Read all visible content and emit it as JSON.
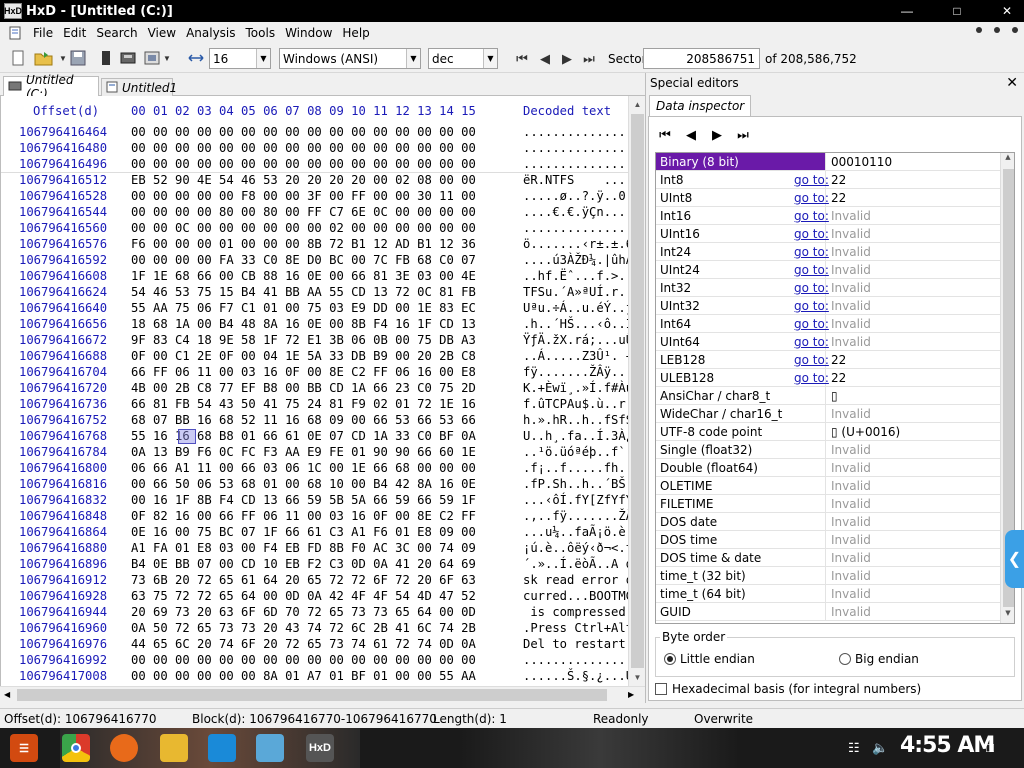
{
  "window": {
    "title": "HxD - [Untitled (C:)]",
    "app_icon_text": "HxD"
  },
  "menu": {
    "items": [
      "File",
      "Edit",
      "Search",
      "View",
      "Analysis",
      "Tools",
      "Window",
      "Help"
    ]
  },
  "toolbar": {
    "bytes_per_row": "16",
    "charset": "Windows (ANSI)",
    "offset_base": "dec",
    "sector_label": "Sector",
    "sector_value": "208586751",
    "sector_of": "of 208,586,752"
  },
  "tabs": [
    {
      "label": "Untitled (C:)"
    },
    {
      "label": "Untitled1"
    }
  ],
  "hex": {
    "header_offset": "Offset(d)",
    "header_cols": "00 01 02 03 04 05 06 07 08 09 10 11 12 13 14 15",
    "header_text": "Decoded text",
    "rows": [
      {
        "off": "106796416464",
        "hex": "00 00 00 00 00 00 00 00 00 00 00 00 00 00 00 00",
        "txt": "................"
      },
      {
        "off": "106796416480",
        "hex": "00 00 00 00 00 00 00 00 00 00 00 00 00 00 00 00",
        "txt": "................"
      },
      {
        "off": "106796416496",
        "hex": "00 00 00 00 00 00 00 00 00 00 00 00 00 00 00 00",
        "txt": "................"
      },
      {
        "off": "106796416512",
        "hex": "EB 52 90 4E 54 46 53 20 20 20 20 00 02 08 00 00",
        "txt": "ëR.NTFS    ....."
      },
      {
        "off": "106796416528",
        "hex": "00 00 00 00 00 F8 00 00 3F 00 FF 00 00 30 11 00",
        "txt": ".....ø..?.ÿ..0.."
      },
      {
        "off": "106796416544",
        "hex": "00 00 00 00 80 00 80 00 FF C7 6E 0C 00 00 00 00",
        "txt": "....€.€.ÿÇn....."
      },
      {
        "off": "106796416560",
        "hex": "00 00 0C 00 00 00 00 00 00 02 00 00 00 00 00 00",
        "txt": "................"
      },
      {
        "off": "106796416576",
        "hex": "F6 00 00 00 01 00 00 00 8B 72 B1 12 AD B1 12 36",
        "txt": "ö.......‹r±.­±.6"
      },
      {
        "off": "106796416592",
        "hex": "00 00 00 00 FA 33 C0 8E D0 BC 00 7C FB 68 C0 07",
        "txt": "....ú3ÀŽÐ¼.|ûhÀ."
      },
      {
        "off": "106796416608",
        "hex": "1F 1E 68 66 00 CB 88 16 0E 00 66 81 3E 03 00 4E",
        "txt": "..hf.Ëˆ...f.>..N"
      },
      {
        "off": "106796416624",
        "hex": "54 46 53 75 15 B4 41 BB AA 55 CD 13 72 0C 81 FB",
        "txt": "TFSu.´A»ªUÍ.r..û"
      },
      {
        "off": "106796416640",
        "hex": "55 AA 75 06 F7 C1 01 00 75 03 E9 DD 00 1E 83 EC",
        "txt": "Uªu.÷Á..u.éÝ..ƒì"
      },
      {
        "off": "106796416656",
        "hex": "18 68 1A 00 B4 48 8A 16 0E 00 8B F4 16 1F CD 13",
        "txt": ".h..´HŠ...‹ô..Í."
      },
      {
        "off": "106796416672",
        "hex": "9F 83 C4 18 9E 58 1F 72 E1 3B 06 0B 00 75 DB A3",
        "txt": "ŸƒÄ.žX.rá;...uÛ£"
      },
      {
        "off": "106796416688",
        "hex": "0F 00 C1 2E 0F 00 04 1E 5A 33 DB B9 00 20 2B C8",
        "txt": "..Á.....Z3Û¹. +È"
      },
      {
        "off": "106796416704",
        "hex": "66 FF 06 11 00 03 16 0F 00 8E C2 FF 06 16 00 E8",
        "txt": "fÿ.......ŽÂÿ...è"
      },
      {
        "off": "106796416720",
        "hex": "4B 00 2B C8 77 EF B8 00 BB CD 1A 66 23 C0 75 2D",
        "txt": "K.+Èwï¸.»Í.f#Àu-"
      },
      {
        "off": "106796416736",
        "hex": "66 81 FB 54 43 50 41 75 24 81 F9 02 01 72 1E 16",
        "txt": "f.ûTCPAu$.ù..r.."
      },
      {
        "off": "106796416752",
        "hex": "68 07 BB 16 68 52 11 16 68 09 00 66 53 66 53 66",
        "txt": "h.».hR..h..fSfSf"
      },
      {
        "off": "106796416768",
        "hex": "55 16 16 68 B8 01 66 61 0E 07 CD 1A 33 C0 BF 0A",
        "txt": "U..h¸.fa..Í.3À¿."
      },
      {
        "off": "106796416784",
        "hex": "0A 13 B9 F6 0C FC F3 AA E9 FE 01 90 90 66 60 1E",
        "txt": "..¹ö.üóªéþ..f`."
      },
      {
        "off": "106796416800",
        "hex": "06 66 A1 11 00 66 03 06 1C 00 1E 66 68 00 00 00",
        "txt": ".f¡..f.....fh..."
      },
      {
        "off": "106796416816",
        "hex": "00 66 50 06 53 68 01 00 68 10 00 B4 42 8A 16 0E",
        "txt": ".fP.Sh..h..´BŠ.."
      },
      {
        "off": "106796416832",
        "hex": "00 16 1F 8B F4 CD 13 66 59 5B 5A 66 59 66 59 1F",
        "txt": "...‹ôÍ.fY[ZfYfY."
      },
      {
        "off": "106796416848",
        "hex": "0F 82 16 00 66 FF 06 11 00 03 16 0F 00 8E C2 FF",
        "txt": ".‚..fÿ.......ŽÂÿ"
      },
      {
        "off": "106796416864",
        "hex": "0E 16 00 75 BC 07 1F 66 61 C3 A1 F6 01 E8 09 00",
        "txt": "...u¼..faÃ¡ö.è.."
      },
      {
        "off": "106796416880",
        "hex": "A1 FA 01 E8 03 00 F4 EB FD 8B F0 AC 3C 00 74 09",
        "txt": "¡ú.è..ôëý‹ð¬<.t."
      },
      {
        "off": "106796416896",
        "hex": "B4 0E BB 07 00 CD 10 EB F2 C3 0D 0A 41 20 64 69",
        "txt": "´.»..Í.ëòÃ..A di"
      },
      {
        "off": "106796416912",
        "hex": "73 6B 20 72 65 61 64 20 65 72 72 6F 72 20 6F 63",
        "txt": "sk read error oc"
      },
      {
        "off": "106796416928",
        "hex": "63 75 72 72 65 64 00 0D 0A 42 4F 4F 54 4D 47 52",
        "txt": "curred...BOOTMGR"
      },
      {
        "off": "106796416944",
        "hex": "20 69 73 20 63 6F 6D 70 72 65 73 73 65 64 00 0D",
        "txt": " is compressed.."
      },
      {
        "off": "106796416960",
        "hex": "0A 50 72 65 73 73 20 43 74 72 6C 2B 41 6C 74 2B",
        "txt": ".Press Ctrl+Alt+"
      },
      {
        "off": "106796416976",
        "hex": "44 65 6C 20 74 6F 20 72 65 73 74 61 72 74 0D 0A",
        "txt": "Del to restart.."
      },
      {
        "off": "106796416992",
        "hex": "00 00 00 00 00 00 00 00 00 00 00 00 00 00 00 00",
        "txt": "................"
      },
      {
        "off": "106796417008",
        "hex": "00 00 00 00 00 00 8A 01 A7 01 BF 01 00 00 55 AA",
        "txt": "......Š.§.¿...Uª"
      }
    ]
  },
  "special_editors": {
    "title": "Special editors",
    "tab": "Data inspector",
    "go_to_label": "go to:",
    "rows": [
      {
        "name": "Binary (8 bit)",
        "go": false,
        "value": "00010110",
        "invalid": false
      },
      {
        "name": "Int8",
        "go": true,
        "value": "22",
        "invalid": false
      },
      {
        "name": "UInt8",
        "go": true,
        "value": "22",
        "invalid": false
      },
      {
        "name": "Int16",
        "go": true,
        "value": "Invalid",
        "invalid": true
      },
      {
        "name": "UInt16",
        "go": true,
        "value": "Invalid",
        "invalid": true
      },
      {
        "name": "Int24",
        "go": true,
        "value": "Invalid",
        "invalid": true
      },
      {
        "name": "UInt24",
        "go": true,
        "value": "Invalid",
        "invalid": true
      },
      {
        "name": "Int32",
        "go": true,
        "value": "Invalid",
        "invalid": true
      },
      {
        "name": "UInt32",
        "go": true,
        "value": "Invalid",
        "invalid": true
      },
      {
        "name": "Int64",
        "go": true,
        "value": "Invalid",
        "invalid": true
      },
      {
        "name": "UInt64",
        "go": true,
        "value": "Invalid",
        "invalid": true
      },
      {
        "name": "LEB128",
        "go": true,
        "value": "22",
        "invalid": false
      },
      {
        "name": "ULEB128",
        "go": true,
        "value": "22",
        "invalid": false
      },
      {
        "name": "AnsiChar / char8_t",
        "go": false,
        "value": "▯",
        "invalid": false
      },
      {
        "name": "WideChar / char16_t",
        "go": false,
        "value": "Invalid",
        "invalid": true
      },
      {
        "name": "UTF-8 code point",
        "go": false,
        "value": "▯ (U+0016)",
        "invalid": false
      },
      {
        "name": "Single (float32)",
        "go": false,
        "value": "Invalid",
        "invalid": true
      },
      {
        "name": "Double (float64)",
        "go": false,
        "value": "Invalid",
        "invalid": true
      },
      {
        "name": "OLETIME",
        "go": false,
        "value": "Invalid",
        "invalid": true
      },
      {
        "name": "FILETIME",
        "go": false,
        "value": "Invalid",
        "invalid": true
      },
      {
        "name": "DOS date",
        "go": false,
        "value": "Invalid",
        "invalid": true
      },
      {
        "name": "DOS time",
        "go": false,
        "value": "Invalid",
        "invalid": true
      },
      {
        "name": "DOS time & date",
        "go": false,
        "value": "Invalid",
        "invalid": true
      },
      {
        "name": "time_t (32 bit)",
        "go": false,
        "value": "Invalid",
        "invalid": true
      },
      {
        "name": "time_t (64 bit)",
        "go": false,
        "value": "Invalid",
        "invalid": true
      },
      {
        "name": "GUID",
        "go": false,
        "value": "Invalid",
        "invalid": true
      }
    ],
    "byte_order_label": "Byte order",
    "little_endian": "Little endian",
    "big_endian": "Big endian",
    "hex_basis": "Hexadecimal basis (for integral numbers)"
  },
  "status": {
    "offset": "Offset(d): 106796416770",
    "block": "Block(d): 106796416770-106796416770",
    "length": "Length(d): 1",
    "mode": "Readonly",
    "write": "Overwrite"
  },
  "taskbar": {
    "clock": "4:55 AM"
  },
  "colors": {
    "offset_blue": "#1a1ab8",
    "selected_row": "#6a1aa8",
    "title_bg": "#000000"
  }
}
